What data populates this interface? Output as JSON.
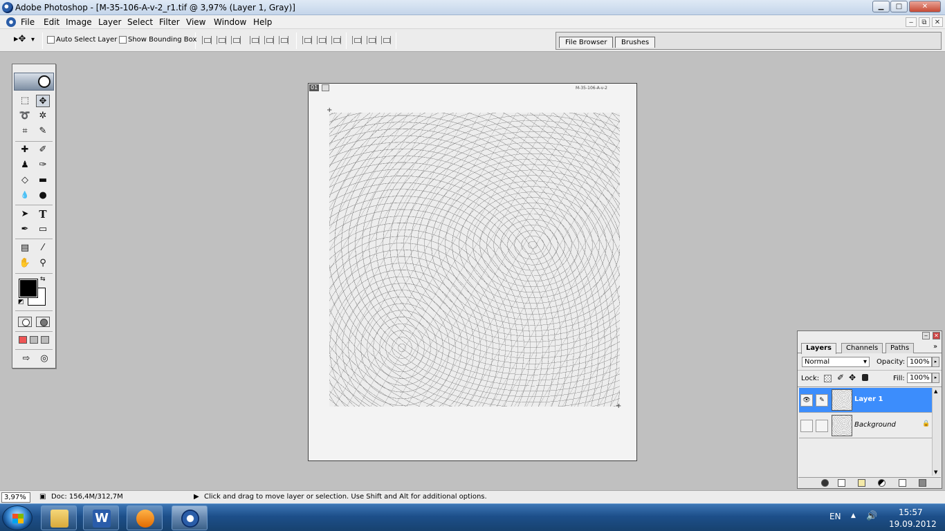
{
  "window": {
    "title": "Adobe Photoshop - [M-35-106-A-v-2_r1.tif @ 3,97% (Layer 1, Gray)]",
    "min": "▁",
    "max": "□",
    "close": "✕"
  },
  "menu": {
    "items": [
      "File",
      "Edit",
      "Image",
      "Layer",
      "Select",
      "Filter",
      "View",
      "Window",
      "Help"
    ],
    "mdi": [
      "‒",
      "⧉",
      "✕"
    ]
  },
  "options": {
    "auto_select_label": "Auto Select Layer",
    "bounding_box_label": "Show Bounding Box",
    "move_tool_glyph": "▸✥",
    "dropdown_glyph": "▾"
  },
  "palette_well": {
    "tabs": [
      "File Browser",
      "Brushes"
    ]
  },
  "toolbox": {
    "tools": [
      {
        "name": "marquee-tool",
        "glyph": "⬚"
      },
      {
        "name": "move-tool",
        "glyph": "✥"
      },
      {
        "name": "lasso-tool",
        "glyph": "➰"
      },
      {
        "name": "magic-wand-tool",
        "glyph": "✲"
      },
      {
        "name": "crop-tool",
        "glyph": "⌗"
      },
      {
        "name": "slice-tool",
        "glyph": "✎"
      },
      {
        "name": "healing-brush-tool",
        "glyph": "✚"
      },
      {
        "name": "brush-tool",
        "glyph": "✐"
      },
      {
        "name": "clone-stamp-tool",
        "glyph": "♟"
      },
      {
        "name": "history-brush-tool",
        "glyph": "✑"
      },
      {
        "name": "eraser-tool",
        "glyph": "◇"
      },
      {
        "name": "gradient-tool",
        "glyph": "▬"
      },
      {
        "name": "blur-tool",
        "glyph": "💧"
      },
      {
        "name": "dodge-tool",
        "glyph": "●"
      },
      {
        "name": "path-selection-tool",
        "glyph": "➤"
      },
      {
        "name": "type-tool",
        "glyph": "T"
      },
      {
        "name": "pen-tool",
        "glyph": "✒"
      },
      {
        "name": "shape-tool",
        "glyph": "▭"
      },
      {
        "name": "notes-tool",
        "glyph": "▤"
      },
      {
        "name": "eyedropper-tool",
        "glyph": "⁄"
      },
      {
        "name": "hand-tool",
        "glyph": "✋"
      },
      {
        "name": "zoom-tool",
        "glyph": "⚲"
      }
    ],
    "swap_glyph": "⇆",
    "default_glyph": "◩"
  },
  "document": {
    "tab_number": "01",
    "sheet_label": "M-35-106-A-v-2"
  },
  "layers_panel": {
    "tabs": [
      "Layers",
      "Channels",
      "Paths"
    ],
    "menu_glyph": "»",
    "blend_mode": "Normal",
    "opacity_label": "Opacity:",
    "opacity_value": "100%",
    "lock_label": "Lock:",
    "fill_label": "Fill:",
    "fill_value": "100%",
    "layers": [
      {
        "name": "Layer 1",
        "visible": "👁",
        "link": "✎"
      },
      {
        "name": "Background",
        "visible": "",
        "link": "",
        "lock": "🔒"
      }
    ]
  },
  "status": {
    "zoom": "3,97%",
    "doc": "Doc: 156,4M/312,7M",
    "hint": "Click and drag to move layer or selection.  Use Shift and Alt for additional options."
  },
  "taskbar": {
    "language": "EN",
    "time": "15:57",
    "date": "19.09.2012",
    "colors": {
      "accent": "#1d4f8a",
      "selection": "#3c8dfc"
    }
  }
}
